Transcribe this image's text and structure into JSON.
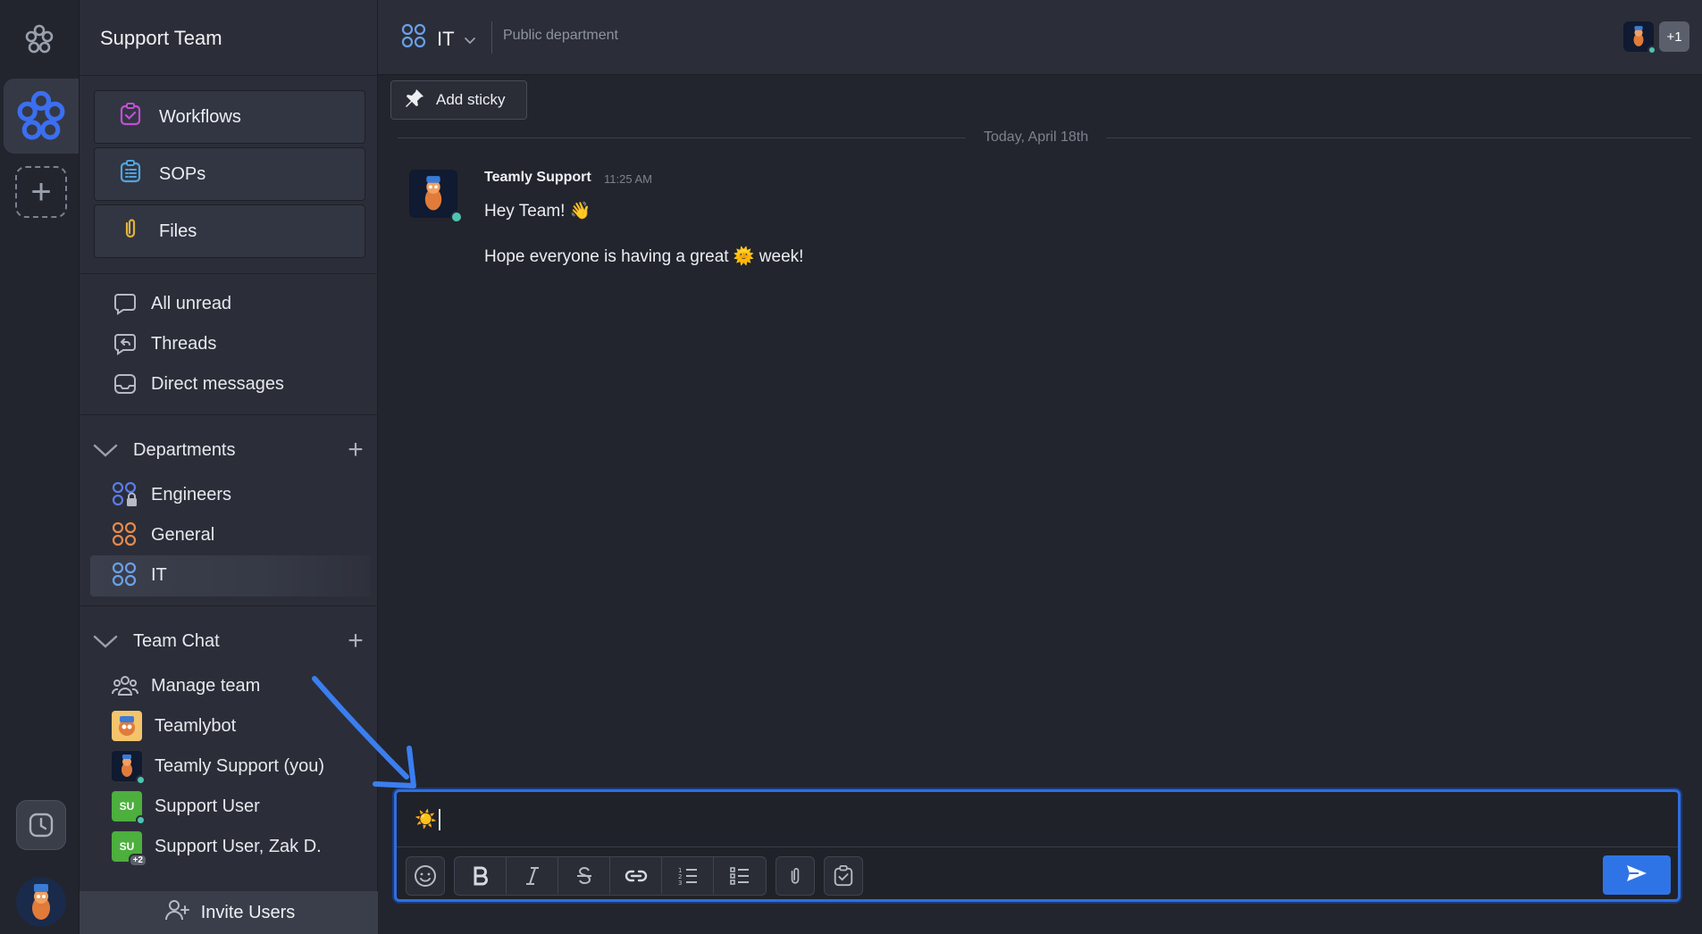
{
  "workspace": {
    "name": "Support Team"
  },
  "sidebar": {
    "cards": [
      {
        "label": "Workflows",
        "icon": "workflows-icon"
      },
      {
        "label": "SOPs",
        "icon": "sops-icon"
      },
      {
        "label": "Files",
        "icon": "paperclip-icon"
      }
    ],
    "views": [
      {
        "label": "All unread",
        "icon": "chat-bubble-icon"
      },
      {
        "label": "Threads",
        "icon": "threads-icon"
      },
      {
        "label": "Direct messages",
        "icon": "inbox-icon"
      }
    ],
    "departments": {
      "title": "Departments",
      "items": [
        {
          "label": "Engineers",
          "color": "#5b7be6",
          "locked": true
        },
        {
          "label": "General",
          "color": "#e58a4e",
          "locked": false
        },
        {
          "label": "IT",
          "color": "#6aa0e8",
          "locked": false,
          "active": true
        }
      ]
    },
    "team_chat": {
      "title": "Team Chat",
      "items": [
        {
          "label": "Manage team",
          "kind": "icon"
        },
        {
          "label": "Teamlybot",
          "kind": "avatar"
        },
        {
          "label": "Teamly Support (you)",
          "kind": "avatar"
        },
        {
          "label": "Support User",
          "kind": "initials",
          "initials": "SU"
        },
        {
          "label": "Support User, Zak D.",
          "kind": "initials",
          "initials": "SU",
          "extra": "+2"
        }
      ]
    },
    "invite_label": "Invite Users"
  },
  "header": {
    "channel": "IT",
    "description": "Public department",
    "more_members": "+1"
  },
  "toolbar": {
    "add_sticky": "Add sticky"
  },
  "messages": {
    "date": "Today, April 18th",
    "items": [
      {
        "author": "Teamly Support",
        "time": "11:25 AM",
        "line1": "Hey Team! 👋",
        "line2_before": "Hope everyone is having a great",
        "line2_emoji": "🌞",
        "line2_after": "week!"
      }
    ]
  },
  "composer": {
    "value": "☀️"
  },
  "colors": {
    "accent": "#2f74e6",
    "online": "#4fc3b1",
    "brand": "#3b6ff0"
  }
}
